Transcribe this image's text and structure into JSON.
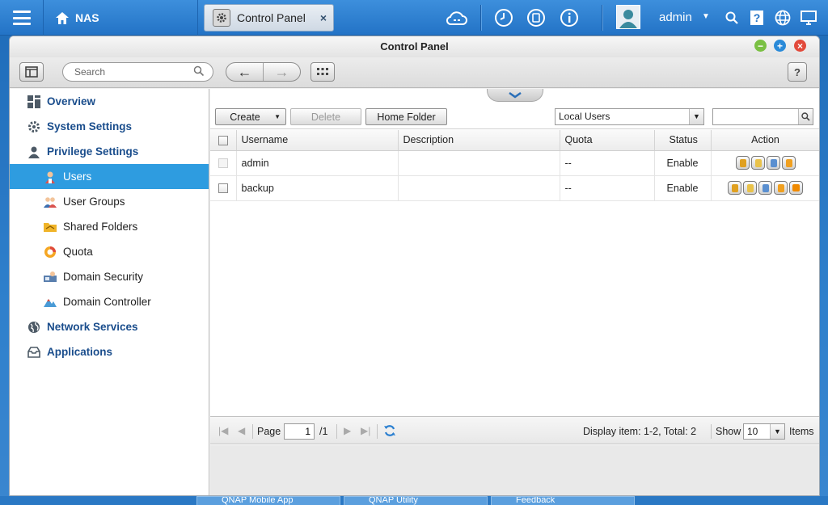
{
  "taskbar": {
    "nas_label": "NAS",
    "active_tab": "Control Panel",
    "close_label": "×",
    "user": "admin",
    "user_caret": "▼"
  },
  "window": {
    "title": "Control Panel",
    "controls": {
      "minimize": "−",
      "maximize": "+",
      "close": "×"
    },
    "colors": {
      "minimize": "#7ac043",
      "maximize": "#2a8ad8",
      "close": "#e24a3b"
    }
  },
  "toolbar": {
    "search_placeholder": "Search",
    "back_label": "←",
    "forward_label": "→",
    "help_label": "?"
  },
  "sidebar": {
    "items": [
      {
        "label": "Overview",
        "level": "top",
        "icon": "overview-icon"
      },
      {
        "label": "System Settings",
        "level": "top",
        "icon": "gear-icon"
      },
      {
        "label": "Privilege Settings",
        "level": "top",
        "icon": "user-icon"
      },
      {
        "label": "Users",
        "level": "sub",
        "icon": "users-icon",
        "selected": true
      },
      {
        "label": "User Groups",
        "level": "sub",
        "icon": "user-groups-icon"
      },
      {
        "label": "Shared Folders",
        "level": "sub",
        "icon": "shared-folder-icon"
      },
      {
        "label": "Quota",
        "level": "sub",
        "icon": "quota-icon"
      },
      {
        "label": "Domain Security",
        "level": "sub",
        "icon": "domain-security-icon"
      },
      {
        "label": "Domain Controller",
        "level": "sub",
        "icon": "domain-controller-icon"
      },
      {
        "label": "Network Services",
        "level": "top",
        "icon": "globe-icon"
      },
      {
        "label": "Applications",
        "level": "top",
        "icon": "applications-icon"
      }
    ],
    "selected_color": "#2e9ce0"
  },
  "actions": {
    "create": "Create",
    "create_caret": "▼",
    "delete": "Delete",
    "home_folder": "Home Folder",
    "user_type": "Local Users",
    "dd_caret": "▼"
  },
  "table": {
    "headers": [
      "Username",
      "Description",
      "Quota",
      "Status",
      "Action"
    ],
    "rows": [
      {
        "username": "admin",
        "description": "",
        "quota": "--",
        "status": "Enable"
      },
      {
        "username": "backup",
        "description": "",
        "quota": "--",
        "status": "Enable"
      }
    ]
  },
  "pager": {
    "page_label": "Page",
    "page_value": "1",
    "page_total": "/1",
    "display_info": "Display item: 1-2, Total: 2",
    "show_label": "Show",
    "show_value": "10",
    "items_label": "Items",
    "dd_caret": "▼"
  },
  "background_taskbar": {
    "tabs": [
      "QNAP Mobile App",
      "QNAP Utility",
      "Feedback"
    ]
  }
}
